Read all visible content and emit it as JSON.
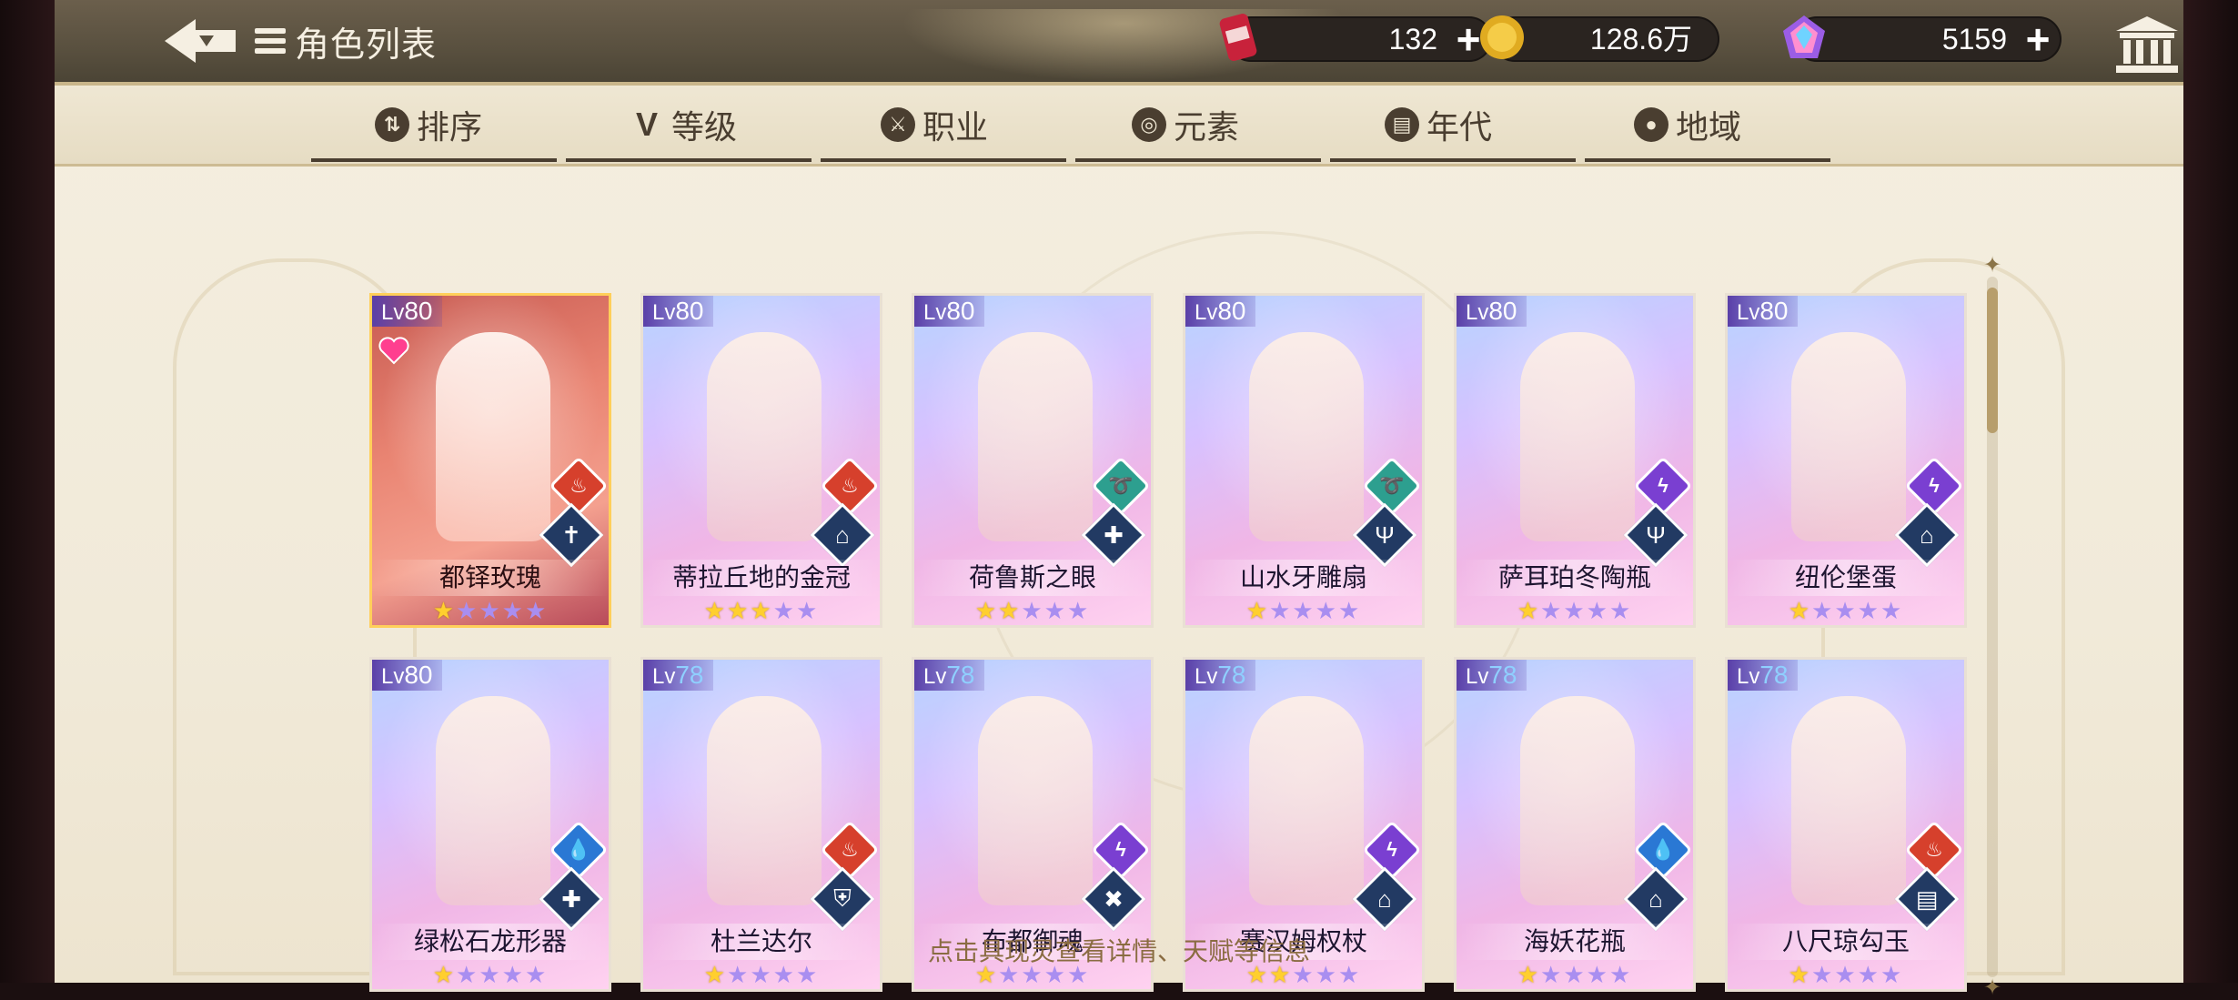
{
  "header": {
    "title": "角色列表",
    "currencies": [
      {
        "name": "stamina",
        "value": "132",
        "icon": "can-icon"
      },
      {
        "name": "gold",
        "value": "128.6万",
        "icon": "coin-icon"
      },
      {
        "name": "gem",
        "value": "5159",
        "icon": "crystal-icon"
      }
    ]
  },
  "filters": [
    {
      "label": "排序",
      "icon_glyph": "⇅"
    },
    {
      "label": "等级",
      "icon_glyph": "V"
    },
    {
      "label": "职业",
      "icon_glyph": "⚔"
    },
    {
      "label": "元素",
      "icon_glyph": "◎"
    },
    {
      "label": "年代",
      "icon_glyph": "▤"
    },
    {
      "label": "地域",
      "icon_glyph": "●"
    }
  ],
  "lv_tag": "Lv",
  "cards": [
    {
      "lv": "80",
      "name": "都铎玫瑰",
      "stars": 1,
      "element": "fire",
      "role": "sword",
      "featured": true
    },
    {
      "lv": "80",
      "name": "蒂拉丘地的金冠",
      "stars": 3,
      "element": "fire",
      "role": "tower"
    },
    {
      "lv": "80",
      "name": "荷鲁斯之眼",
      "stars": 2,
      "element": "wind",
      "role": "cross"
    },
    {
      "lv": "80",
      "name": "山水牙雕扇",
      "stars": 1,
      "element": "wind",
      "role": "trident"
    },
    {
      "lv": "80",
      "name": "萨耳珀冬陶瓶",
      "stars": 1,
      "element": "thunder",
      "role": "trident"
    },
    {
      "lv": "80",
      "name": "纽伦堡蛋",
      "stars": 1,
      "element": "thunder",
      "role": "tower"
    },
    {
      "lv": "80",
      "name": "绿松石龙形器",
      "stars": 1,
      "element": "water",
      "role": "cross"
    },
    {
      "lv": "78",
      "name": "杜兰达尔",
      "stars": 1,
      "element": "fire",
      "role": "shield"
    },
    {
      "lv": "78",
      "name": "布都御魂",
      "stars": 1,
      "element": "thunder",
      "role": "swords"
    },
    {
      "lv": "78",
      "name": "赛汉姆权杖",
      "stars": 2,
      "element": "thunder",
      "role": "tower"
    },
    {
      "lv": "78",
      "name": "海妖花瓶",
      "stars": 1,
      "element": "water",
      "role": "tower"
    },
    {
      "lv": "78",
      "name": "八尺琼勾玉",
      "stars": 1,
      "element": "fire",
      "role": "book"
    }
  ],
  "element_colors": {
    "fire": "#d6402c",
    "wind": "#2d9f8f",
    "thunder": "#7a3fd1",
    "water": "#2a78d4"
  },
  "hint": "点击具现灵查看详情、天赋等信息"
}
